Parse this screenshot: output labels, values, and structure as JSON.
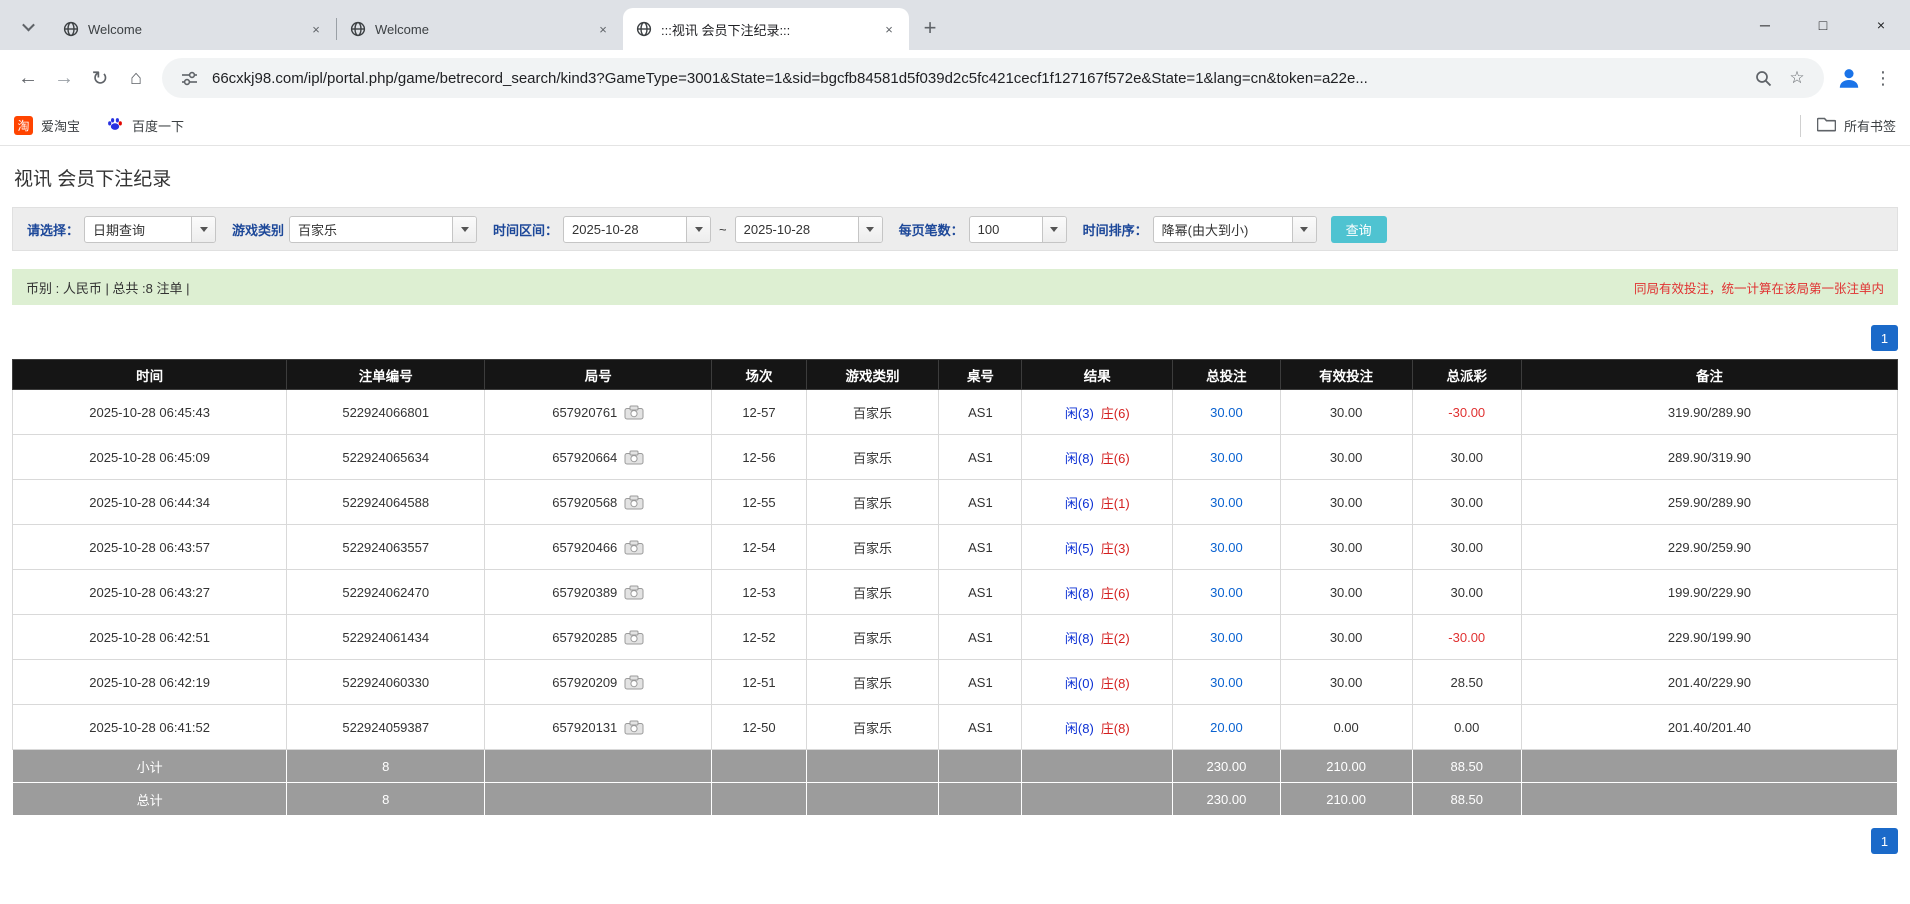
{
  "icons": {
    "back": "←",
    "forward": "→",
    "refresh": "↻",
    "home": "⌂",
    "star": "☆",
    "menu": "⋮",
    "close": "×",
    "minimize": "─",
    "maximize": "□",
    "new_tab": "+"
  },
  "browser": {
    "tabs": [
      {
        "title": "Welcome"
      },
      {
        "title": "Welcome"
      },
      {
        "title": ":::视讯 会员下注纪录:::"
      }
    ],
    "url": "66cxkj98.com/ipl/portal.php/game/betrecord_search/kind3?GameType=3001&State=1&sid=bgcfb84581d5f039d2c5fc421cecf1f127167f572e&State=1&lang=cn&token=a22e...",
    "bookmarks": {
      "taobao_label": "爱淘宝",
      "taobao_glyph": "淘",
      "baidu_label": "百度一下",
      "all_bookmarks_label": "所有书签"
    }
  },
  "page": {
    "title": "视讯 会员下注纪录",
    "filters": {
      "select_label": "请选择：",
      "select_value": "日期查询",
      "game_type_label": "游戏类别",
      "game_type_value": "百家乐",
      "range_label": "时间区间：",
      "date_from": "2025-10-28",
      "range_separator": "~",
      "date_to": "2025-10-28",
      "page_size_label": "每页笔数：",
      "page_size_value": "100",
      "sort_label": "时间排序：",
      "sort_value": "降幂(由大到小)",
      "search_button": "查询"
    },
    "info_bar": {
      "summary": "币别 : 人民币 | 总共 :8 注单 |",
      "notice": "同局有效投注，统一计算在该局第一张注单内"
    },
    "pagination": {
      "current": "1"
    },
    "table": {
      "headers": [
        "时间",
        "注单编号",
        "局号",
        "场次",
        "游戏类别",
        "桌号",
        "结果",
        "总投注",
        "有效投注",
        "总派彩",
        "备注"
      ],
      "rows": [
        {
          "time": "2025-10-28 06:45:43",
          "bet_id": "522924066801",
          "round": "657920761",
          "session": "12-57",
          "game": "百家乐",
          "table": "AS1",
          "player": "闲(3)",
          "banker": "庄(6)",
          "total_bet": "30.00",
          "valid_bet": "30.00",
          "payout": "-30.00",
          "note": "319.90/289.90"
        },
        {
          "time": "2025-10-28 06:45:09",
          "bet_id": "522924065634",
          "round": "657920664",
          "session": "12-56",
          "game": "百家乐",
          "table": "AS1",
          "player": "闲(8)",
          "banker": "庄(6)",
          "total_bet": "30.00",
          "valid_bet": "30.00",
          "payout": "30.00",
          "note": "289.90/319.90"
        },
        {
          "time": "2025-10-28 06:44:34",
          "bet_id": "522924064588",
          "round": "657920568",
          "session": "12-55",
          "game": "百家乐",
          "table": "AS1",
          "player": "闲(6)",
          "banker": "庄(1)",
          "total_bet": "30.00",
          "valid_bet": "30.00",
          "payout": "30.00",
          "note": "259.90/289.90"
        },
        {
          "time": "2025-10-28 06:43:57",
          "bet_id": "522924063557",
          "round": "657920466",
          "session": "12-54",
          "game": "百家乐",
          "table": "AS1",
          "player": "闲(5)",
          "banker": "庄(3)",
          "total_bet": "30.00",
          "valid_bet": "30.00",
          "payout": "30.00",
          "note": "229.90/259.90"
        },
        {
          "time": "2025-10-28 06:43:27",
          "bet_id": "522924062470",
          "round": "657920389",
          "session": "12-53",
          "game": "百家乐",
          "table": "AS1",
          "player": "闲(8)",
          "banker": "庄(6)",
          "total_bet": "30.00",
          "valid_bet": "30.00",
          "payout": "30.00",
          "note": "199.90/229.90"
        },
        {
          "time": "2025-10-28 06:42:51",
          "bet_id": "522924061434",
          "round": "657920285",
          "session": "12-52",
          "game": "百家乐",
          "table": "AS1",
          "player": "闲(8)",
          "banker": "庄(2)",
          "total_bet": "30.00",
          "valid_bet": "30.00",
          "payout": "-30.00",
          "note": "229.90/199.90"
        },
        {
          "time": "2025-10-28 06:42:19",
          "bet_id": "522924060330",
          "round": "657920209",
          "session": "12-51",
          "game": "百家乐",
          "table": "AS1",
          "player": "闲(0)",
          "banker": "庄(8)",
          "total_bet": "30.00",
          "valid_bet": "30.00",
          "payout": "28.50",
          "note": "201.40/229.90"
        },
        {
          "time": "2025-10-28 06:41:52",
          "bet_id": "522924059387",
          "round": "657920131",
          "session": "12-50",
          "game": "百家乐",
          "table": "AS1",
          "player": "闲(8)",
          "banker": "庄(8)",
          "total_bet": "20.00",
          "valid_bet": "0.00",
          "payout": "0.00",
          "note": "201.40/201.40"
        }
      ],
      "subtotal": {
        "label": "小计",
        "count": "8",
        "total_bet": "230.00",
        "valid_bet": "210.00",
        "payout": "88.50"
      },
      "total": {
        "label": "总计",
        "count": "8",
        "total_bet": "230.00",
        "valid_bet": "210.00",
        "payout": "88.50"
      }
    }
  }
}
